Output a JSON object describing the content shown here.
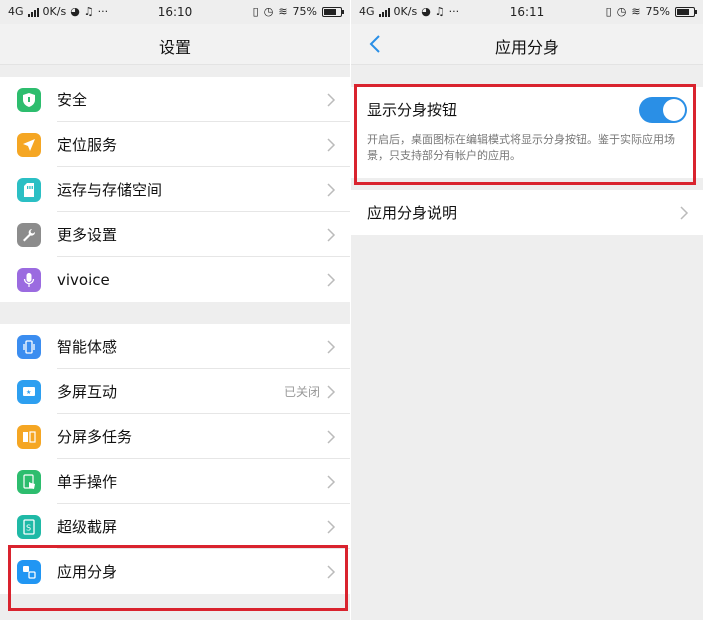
{
  "status_left": {
    "network": "4G",
    "speed": "0K/s",
    "time": "16:10",
    "battery": "75%"
  },
  "status_right": {
    "network": "4G",
    "speed": "0K/s",
    "time": "16:11",
    "battery": "75%"
  },
  "settings": {
    "title": "设置",
    "group1": [
      {
        "label": "安全",
        "icon": "shield-icon",
        "color": "#2dbd6e"
      },
      {
        "label": "定位服务",
        "icon": "location-icon",
        "color": "#f5a623"
      },
      {
        "label": "运存与存储空间",
        "icon": "storage-icon",
        "color": "#2bbfc4"
      },
      {
        "label": "更多设置",
        "icon": "wrench-icon",
        "color": "#8c8c8c"
      },
      {
        "label": "vivoice",
        "icon": "microphone-icon",
        "color": "#9b6be0"
      }
    ],
    "group2": [
      {
        "label": "智能体感",
        "icon": "motion-icon",
        "color": "#3b8df0",
        "value": ""
      },
      {
        "label": "多屏互动",
        "icon": "multiscreen-icon",
        "color": "#2d9ff0",
        "value": "已关闭"
      },
      {
        "label": "分屏多任务",
        "icon": "splitscreen-icon",
        "color": "#f5a623",
        "value": ""
      },
      {
        "label": "单手操作",
        "icon": "one-hand-icon",
        "color": "#2dbd6e",
        "value": ""
      },
      {
        "label": "超级截屏",
        "icon": "screenshot-icon",
        "color": "#1fb9a6",
        "value": ""
      },
      {
        "label": "应用分身",
        "icon": "app-clone-icon",
        "color": "#2196f3",
        "value": ""
      }
    ]
  },
  "app_clone": {
    "title": "应用分身",
    "toggle_label": "显示分身按钮",
    "toggle_on": true,
    "description": "开启后，桌面图标在编辑模式将显示分身按钮。鉴于实际应用场景，只支持部分有帐户的应用。",
    "info_label": "应用分身说明"
  },
  "colors": {
    "highlight": "#d9232e",
    "toggle": "#2a8fe6",
    "background": "#eeeeee"
  }
}
